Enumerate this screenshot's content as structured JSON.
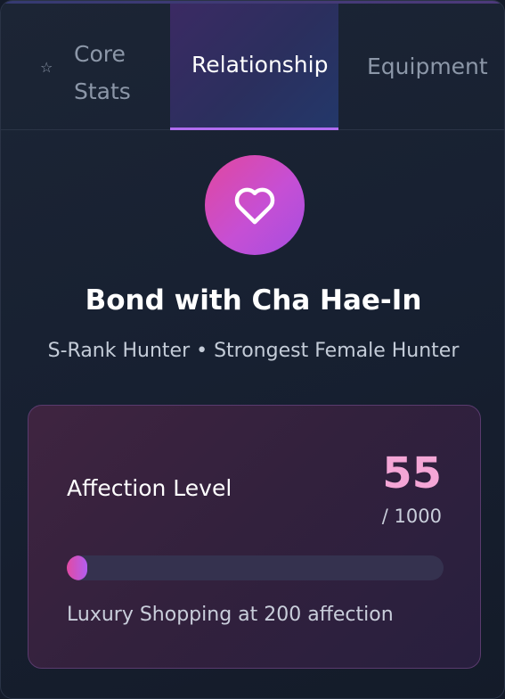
{
  "tabs": [
    {
      "label": "Core\nStats",
      "icon": "star-icon",
      "active": false
    },
    {
      "label": "Relationship",
      "active": true
    },
    {
      "label": "Equipment",
      "active": false
    }
  ],
  "relationship": {
    "icon": "heart-icon",
    "title": "Bond with Cha Hae-In",
    "subtitle": "S-Rank Hunter • Strongest Female Hunter"
  },
  "affection": {
    "label": "Affection Level",
    "value": "55",
    "max_text": "/ 1000",
    "progress_fraction": 0.055,
    "milestone": "Luxury Shopping at 200 affection"
  },
  "colors": {
    "accent": "#b06cf0",
    "heart_gradient_start": "#e1479e",
    "heart_gradient_end": "#a64ee0",
    "affection_value": "#f4a6d6"
  }
}
